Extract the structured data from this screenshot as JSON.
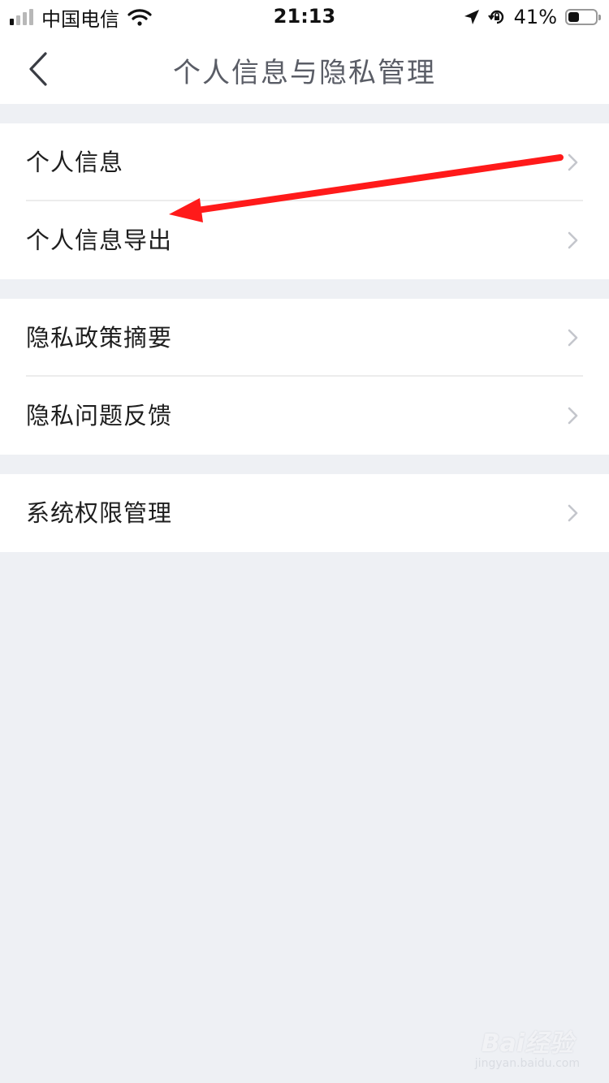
{
  "status_bar": {
    "carrier": "中国电信",
    "time": "21:13",
    "battery_percent": "41%",
    "battery_level": 0.41,
    "signal_bars_active": 1,
    "signal_bars_total": 4,
    "icons": [
      "signal-icon",
      "wifi-icon",
      "location-arrow-icon",
      "rotation-lock-icon",
      "battery-icon"
    ]
  },
  "nav": {
    "title": "个人信息与隐私管理",
    "back_icon": "chevron-left-icon"
  },
  "groups": [
    {
      "items": [
        {
          "label": "个人信息"
        },
        {
          "label": "个人信息导出"
        }
      ]
    },
    {
      "items": [
        {
          "label": "隐私政策摘要"
        },
        {
          "label": "隐私问题反馈"
        }
      ]
    },
    {
      "items": [
        {
          "label": "系统权限管理"
        }
      ]
    }
  ],
  "annotation": {
    "type": "arrow",
    "color": "#ff1a1a"
  },
  "watermark": {
    "logo": "Bai经验",
    "url": "jingyan.baidu.com"
  },
  "colors": {
    "background": "#eef0f4",
    "card": "#ffffff",
    "title": "#5a5d66",
    "chevron": "#c4c6cc",
    "arrow": "#ff1a1a"
  }
}
